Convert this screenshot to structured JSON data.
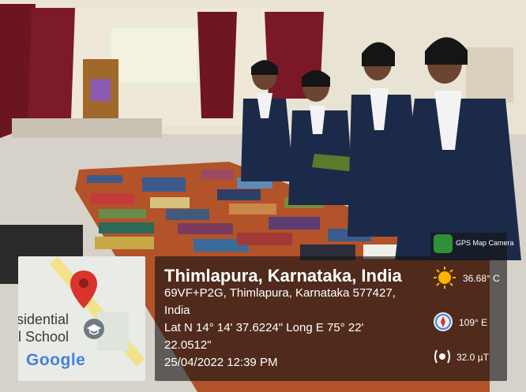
{
  "photo": {
    "description_icon": "photo-scene",
    "colors": {
      "blazer": "#1c2a4a",
      "shirt": "#f3f3f3",
      "table": "#b5562b",
      "curtain": "#6a1420",
      "floor": "#d6d1c8",
      "wall": "#ece6d6"
    }
  },
  "map": {
    "label_line1": "sidential",
    "label_line2": "l School",
    "provider": "Google",
    "pin_icon": "map-pin-icon",
    "grad_icon": "graduation-cap-icon"
  },
  "app": {
    "name": "GPS Map Camera",
    "icon": "gps-camera-icon"
  },
  "location": {
    "title": "Thimlapura, Karnataka, India",
    "address_line1": "69VF+P2G, Thimlapura, Karnataka 577427,",
    "address_line2": "India",
    "latlong_line1": "Lat N 14° 14' 37.6224\" Long E 75° 22'",
    "latlong_line2": "22.0512\"",
    "datetime": "25/04/2022 12:39 PM"
  },
  "stats": {
    "temperature": "36.68° C",
    "direction": "109° E",
    "magnetic": "32.0 µT",
    "icons": [
      "sun-icon",
      "compass-icon",
      "magnet-icon"
    ]
  }
}
